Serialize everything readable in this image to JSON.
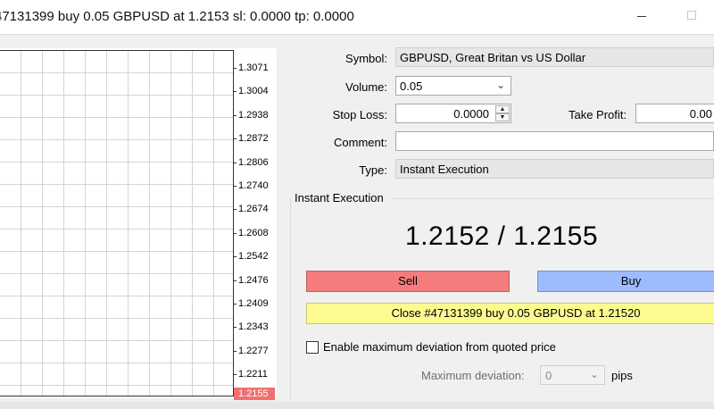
{
  "window": {
    "title": "47131399 buy 0.05 GBPUSD at 1.2153 sl: 0.0000 tp: 0.0000"
  },
  "chart": {
    "price_ticks": [
      "1.3071",
      "1.3004",
      "1.2938",
      "1.2872",
      "1.2806",
      "1.2740",
      "1.2674",
      "1.2608",
      "1.2542",
      "1.2476",
      "1.2409",
      "1.2343",
      "1.2277",
      "1.2211"
    ],
    "current_price": "1.2155",
    "current_price_color": "#f07070"
  },
  "form": {
    "symbol_label": "Symbol:",
    "symbol_value": "GBPUSD, Great Britan vs US Dollar",
    "volume_label": "Volume:",
    "volume_value": "0.05",
    "stop_loss_label": "Stop Loss:",
    "stop_loss_value": "0.0000",
    "take_profit_label": "Take Profit:",
    "take_profit_value": "0.00",
    "comment_label": "Comment:",
    "comment_value": "",
    "type_label": "Type:",
    "type_value": "Instant Execution"
  },
  "execution": {
    "section_label": "Instant Execution",
    "quote": "1.2152 / 1.2155",
    "sell_label": "Sell",
    "buy_label": "Buy",
    "close_label": "Close #47131399 buy 0.05 GBPUSD at 1.21520",
    "sell_color": "#f47c7c",
    "buy_color": "#9dbbff",
    "close_color": "#fbfb90"
  },
  "deviation": {
    "checkbox_label": "Enable maximum deviation from quoted price",
    "checked": false,
    "max_label": "Maximum deviation:",
    "max_value": "0",
    "unit": "pips"
  }
}
